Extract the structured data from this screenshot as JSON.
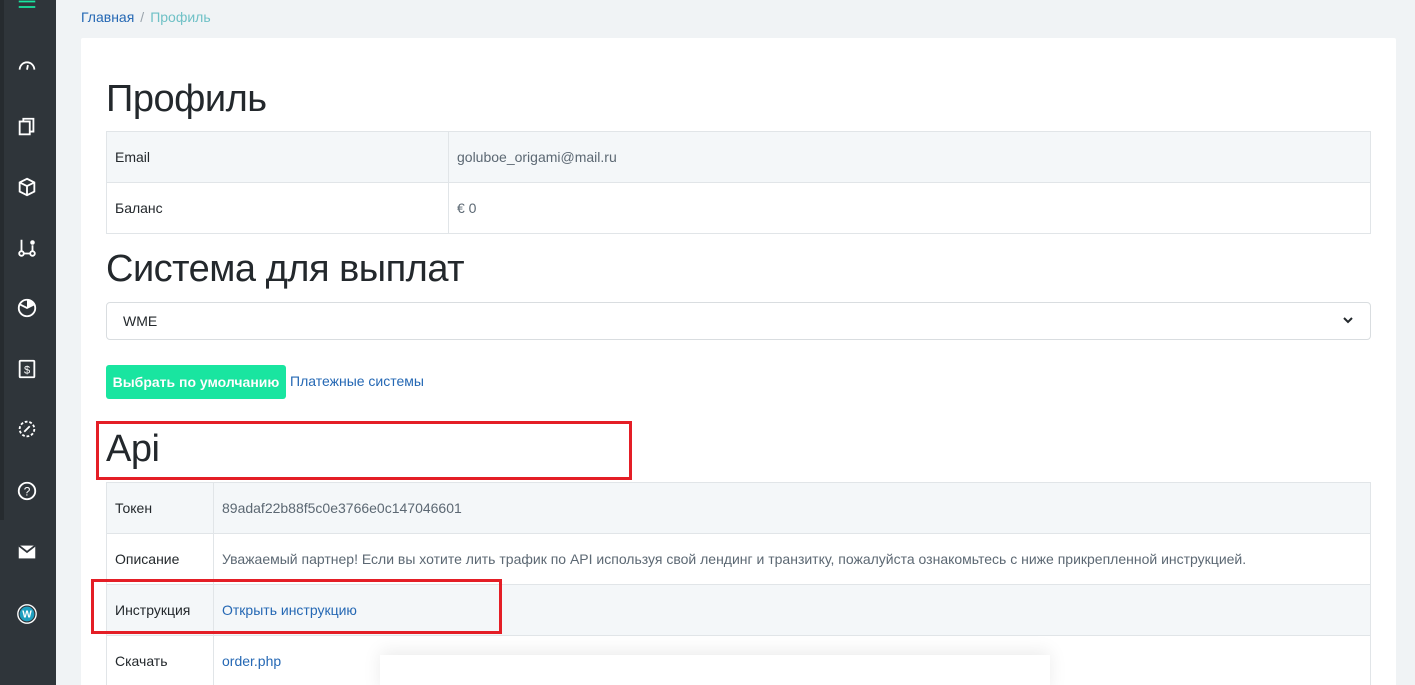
{
  "breadcrumb": {
    "home": "Главная",
    "separator": "/",
    "current": "Профиль"
  },
  "sidebar": {
    "icons": [
      "menu-icon",
      "dashboard-icon",
      "documents-icon",
      "box-icon",
      "flow-icon",
      "pie-icon",
      "dollar-icon",
      "settings-icon",
      "help-icon",
      "mail-icon",
      "wordpress-icon"
    ]
  },
  "profile": {
    "title": "Профиль",
    "rows": [
      {
        "label": "Email",
        "value": "goluboe_origami@mail.ru"
      },
      {
        "label": "Баланс",
        "value": "€ 0"
      }
    ]
  },
  "payout": {
    "title": "Система для выплат",
    "selected": "WME",
    "default_button": "Выбрать по умолчанию",
    "systems_link": "Платежные системы"
  },
  "api": {
    "title": "Api",
    "rows": [
      {
        "label": "Токен",
        "value": "89adaf22b88f5c0e3766e0c147046601"
      },
      {
        "label": "Описание",
        "value": "Уважаемый партнер! Если вы хотите лить трафик по API используя свой лендинг и транзитку, пожалуйста ознакомьтесь с ниже прикрепленной инструкцией."
      },
      {
        "label": "Инструкция",
        "value": "Открыть инструкцию"
      },
      {
        "label": "Скачать",
        "value": "order.php"
      }
    ]
  },
  "colors": {
    "sidebar": "#2f353a",
    "accent_green": "#19e5a0",
    "link": "#2568b4",
    "highlight": "#e41e26"
  }
}
